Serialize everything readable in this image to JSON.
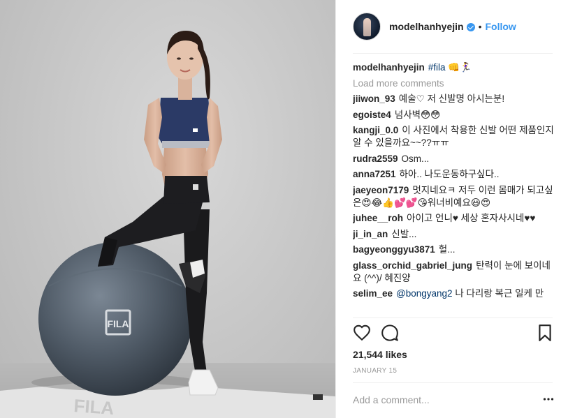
{
  "post": {
    "username": "modelhanhyejin",
    "follow_label": "Follow",
    "separator": "•",
    "likes": "21,544 likes",
    "date": "JANUARY 15",
    "add_comment_placeholder": "Add a comment..."
  },
  "caption": {
    "username": "modelhanhyejin",
    "hashtag": "#fila",
    "emojis": "👊🏃‍♀️"
  },
  "load_more": "Load more comments",
  "comments": [
    {
      "user": "jiiwon_93",
      "text": "예술♡ 저 신발명 아시는분!"
    },
    {
      "user": "egoiste4",
      "text": "넘사벽😳😳"
    },
    {
      "user": "kangji_0.0",
      "text": "이 사진에서 착용한 신발 어떤 제품인지 알 수 있을까요~~??ㅠㅠ"
    },
    {
      "user": "rudra2559",
      "text": "Osm..."
    },
    {
      "user": "anna7251",
      "text": "하아.. 나도운동하구싶다.."
    },
    {
      "user": "jaeyeon7179",
      "text": "멋지네요ㅋ 저두 이런 몸매가 되고싶은😍😂👍💕💕😘워너비예요😃😍"
    },
    {
      "user": "juhee__roh",
      "text": "아이고 언니♥ 세상 혼자사시네♥♥"
    },
    {
      "user": "ji_in_an",
      "text": "신발..."
    },
    {
      "user": "bagyeonggyu3871",
      "text": "헐..."
    },
    {
      "user": "glass_orchid_gabriel_jung",
      "text": "탄력이 눈에 보이네요 (^^)/ 혜진양"
    },
    {
      "user": "selim_ee",
      "mention": "@bongyang2",
      "text": "나 다리랑 복근 일케 만"
    }
  ],
  "photo": {
    "ball_logo": "FILA",
    "floor_text": "FILA"
  },
  "icons": {
    "avatar": "avatar",
    "verified": "verified-badge-icon",
    "like": "heart-icon",
    "comment": "comment-bubble-icon",
    "save": "bookmark-icon",
    "more": "more-options-icon"
  },
  "colors": {
    "link_blue": "#3897f0",
    "text": "#262626",
    "muted": "#999999",
    "divider": "#efefef",
    "ball": "#4f5a66",
    "top": "#2b3a66"
  }
}
